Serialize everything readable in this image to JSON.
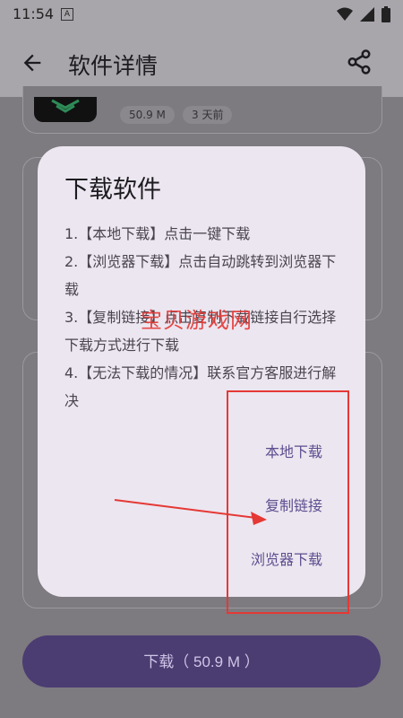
{
  "status": {
    "time": "11:54",
    "badge": "A"
  },
  "appbar": {
    "title": "软件详情"
  },
  "app": {
    "size_chip": "50.9 M",
    "date_chip": "3 天前"
  },
  "dialog": {
    "title": "下载软件",
    "steps": [
      "1.【本地下载】点击一键下载",
      "2.【浏览器下载】点击自动跳转到浏览器下载",
      "3.【复制链接】点击复制下载链接自行选择下载方式进行下载",
      "4.【无法下载的情况】联系官方客服进行解决"
    ],
    "actions": {
      "local": "本地下载",
      "copy": "复制链接",
      "browser": "浏览器下载"
    }
  },
  "watermark": "宝贝游戏网",
  "download_button": "下载（ 50.9 M ）",
  "colors": {
    "accent": "#5b4e8f",
    "button": "#4b3c72",
    "annotation": "#e53935"
  }
}
